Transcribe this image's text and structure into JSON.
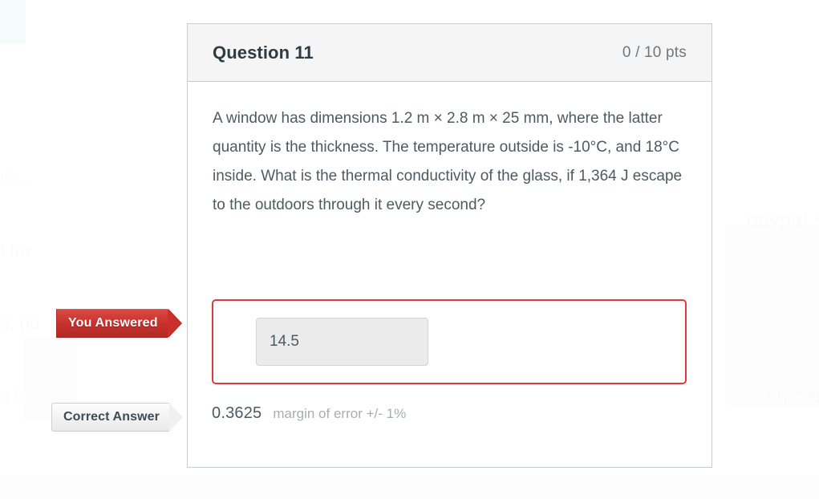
{
  "card": {
    "title": "Question 11",
    "score": "0 / 10 pts",
    "question_text": "A window has dimensions 1.2 m × 2.8 m × 25 mm, where the latter quantity is the thickness. The temperature outside is -10°C, and 18°C inside. What is the thermal conductivity of the glass, if 1,364 J escape to the outdoors through it every second?"
  },
  "answered": {
    "badge_label": "You Answered",
    "value": "14.5"
  },
  "correct": {
    "badge_label": "Correct Answer",
    "value": "0.3625",
    "margin": "margin of error +/- 1%"
  },
  "background_ghost_text": {
    "left_1": "tio..",
    "left_2": "t fro",
    "left_3": "e, pu",
    "left_4": "u to",
    "right_1": "paypal + fiv",
    "right_2": "when can we"
  },
  "colors": {
    "accent_red": "#c9302c",
    "card_border": "#c7cdd1",
    "header_bg": "#f5f5f5",
    "body_text": "#4c5b62",
    "muted_text": "#a8adb2"
  }
}
